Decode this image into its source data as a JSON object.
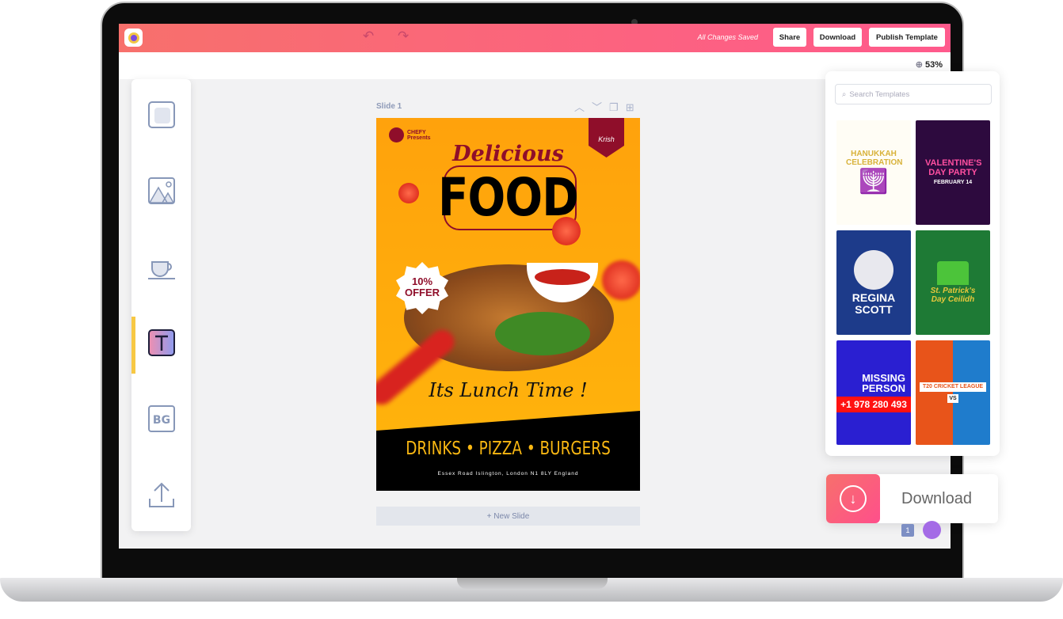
{
  "topbar": {
    "status": "All Changes Saved",
    "share": "Share",
    "download": "Download",
    "publish": "Publish Template",
    "undo_icon": "undo-icon",
    "redo_icon": "redo-icon"
  },
  "zoom": {
    "level": "53%"
  },
  "tools": [
    {
      "name": "elements"
    },
    {
      "name": "images"
    },
    {
      "name": "illustrations"
    },
    {
      "name": "text",
      "active": true
    },
    {
      "name": "background",
      "label": "BG"
    },
    {
      "name": "upload"
    }
  ],
  "slide": {
    "label": "Slide 1",
    "new_slide": "+ New Slide"
  },
  "poster": {
    "brand": "CHEFY",
    "brand_sub": "Presents",
    "badge": "Krish",
    "headline1": "Delicious",
    "headline2": "FOOD",
    "offer1": "10%",
    "offer2": "OFFER",
    "tagline": "Its Lunch Time !",
    "menu": "DRINKS  •  PIZZA  •  BURGERS",
    "address": "Essex Road Islington, London N1 8LY England"
  },
  "templates": {
    "search_placeholder": "Search Templates",
    "items": [
      {
        "title": "HANUKKAH CELEBRATION",
        "bg": "#fffdf5",
        "fg": "#d8b23a"
      },
      {
        "title": "VALENTINE'S DAY PARTY",
        "sub": "FEBRUARY 14",
        "bg": "#2d0a3e",
        "fg": "#ff4fa0"
      },
      {
        "title": "REGINA SCOTT",
        "bg": "#1d3b8a",
        "fg": "#fff"
      },
      {
        "title": "St. Patrick's Day Ceilidh",
        "bg": "#1e7a35",
        "fg": "#e7c83c"
      },
      {
        "title": "MISSING PERSON",
        "sub": "+1 978 280 493",
        "bg": "#2a1fd1",
        "fg": "#fff"
      },
      {
        "title": "T20 CRICKET LEAGUE",
        "sub": "VS",
        "bg": "#e8541a",
        "fg": "#fff"
      }
    ]
  },
  "download_card": {
    "label": "Download"
  },
  "footer": {
    "page_count": "1"
  },
  "colors": {
    "accent_start": "#f7706c",
    "accent_end": "#ff5a8c",
    "active_tool": "#f7c844"
  }
}
